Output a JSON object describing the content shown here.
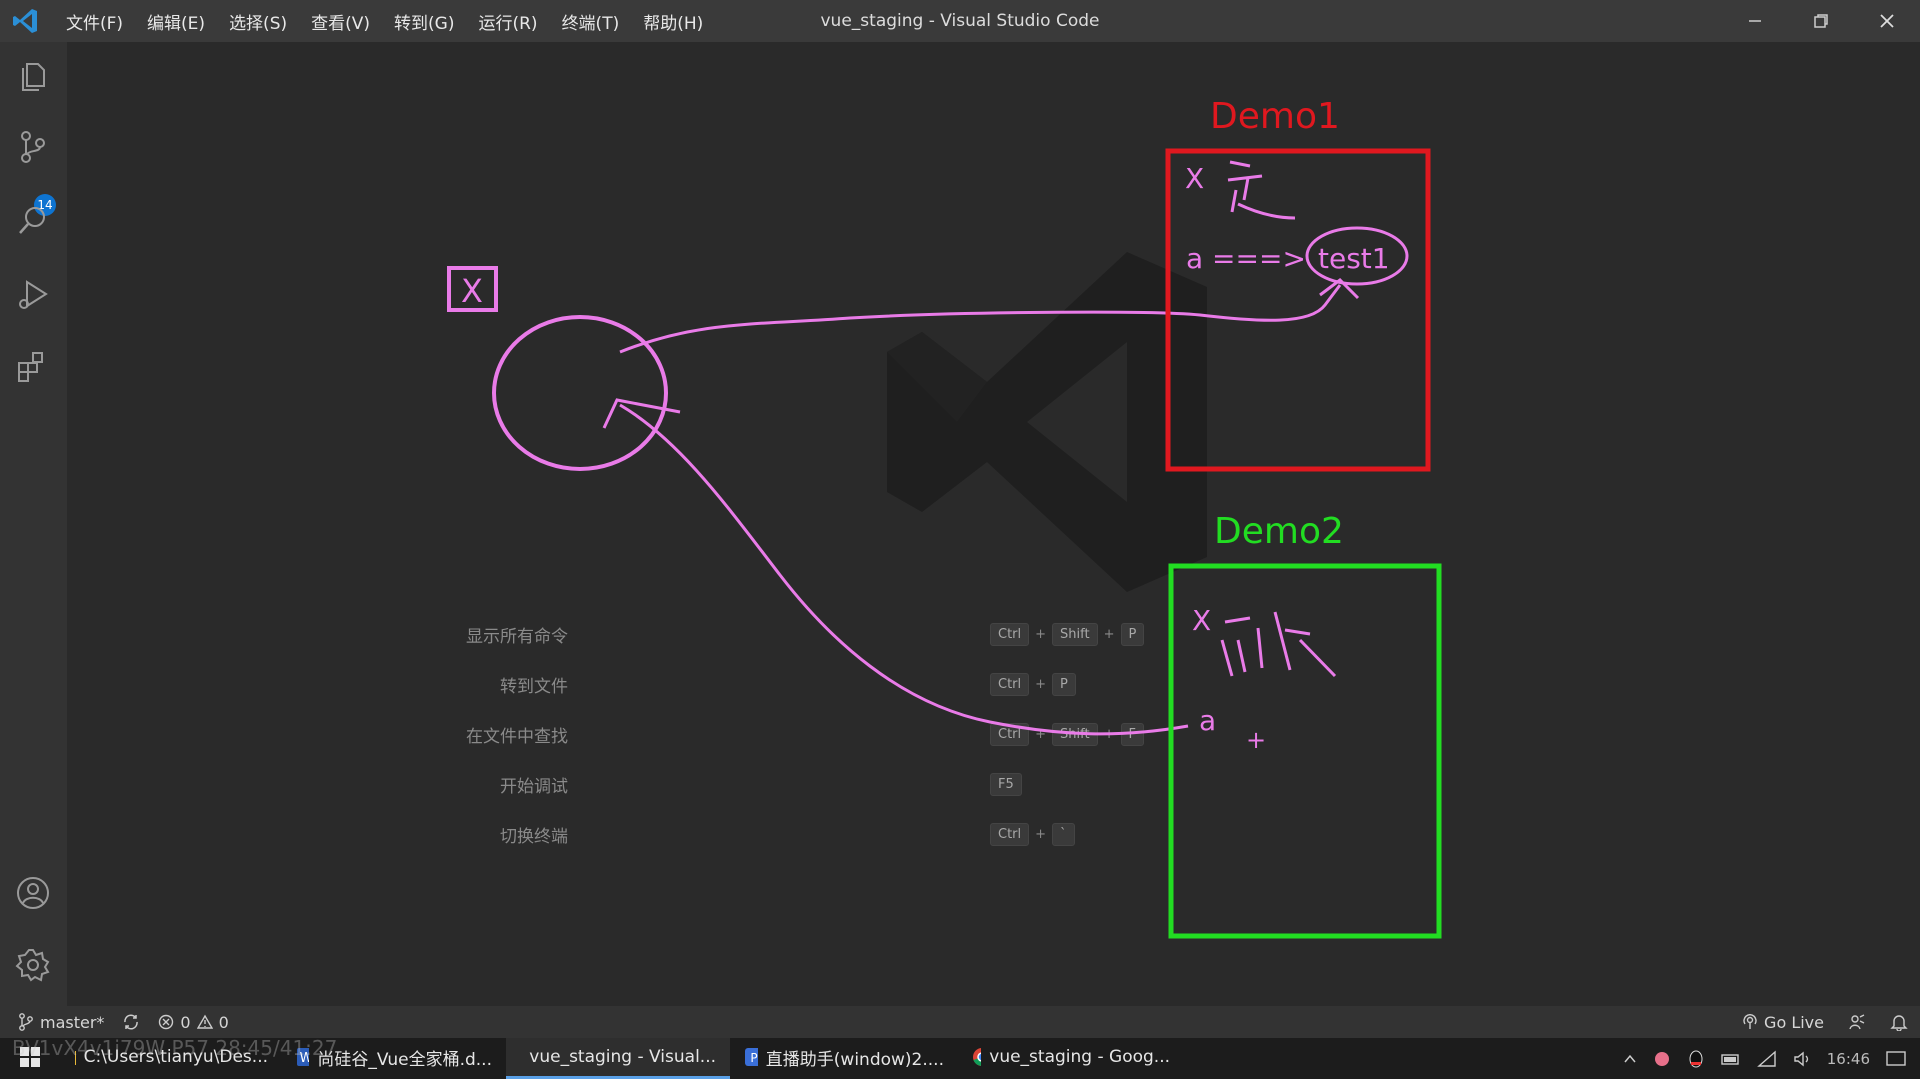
{
  "window": {
    "title": "vue_staging - Visual Studio Code",
    "menu": [
      "文件(F)",
      "编辑(E)",
      "选择(S)",
      "查看(V)",
      "转到(G)",
      "运行(R)",
      "终端(T)",
      "帮助(H)"
    ]
  },
  "activity_bar": {
    "scm_badge": "14"
  },
  "shortcuts": [
    {
      "label": "显示所有命令",
      "keys": [
        "Ctrl",
        "+",
        "Shift",
        "+",
        "P"
      ]
    },
    {
      "label": "转到文件",
      "keys": [
        "Ctrl",
        "+",
        "P"
      ]
    },
    {
      "label": "在文件中查找",
      "keys": [
        "Ctrl",
        "+",
        "Shift",
        "+",
        "F"
      ]
    },
    {
      "label": "开始调试",
      "keys": [
        "F5"
      ]
    },
    {
      "label": "切换终端",
      "keys": [
        "Ctrl",
        "+",
        "`"
      ]
    }
  ],
  "annotations": {
    "x_box": "X",
    "demo1_title": "Demo1",
    "demo1_x": "X",
    "demo1_a": "a ===>",
    "demo1_test": "test1",
    "demo2_title": "Demo2",
    "demo2_x": "X",
    "demo2_a": "a",
    "demo2_plus": "+",
    "colors": {
      "demo1": "#e0181f",
      "demo2": "#22dd22",
      "pen": "#e97be8"
    }
  },
  "statusbar": {
    "branch": "master*",
    "errors": "0",
    "warnings": "0",
    "go_live": "Go Live"
  },
  "taskbar": {
    "items": [
      {
        "label": "C:\\Users\\tianyu\\Des...",
        "icon": "folder-icon"
      },
      {
        "label": "尚硅谷_Vue全家桶.d...",
        "icon": "word-icon"
      },
      {
        "label": "vue_staging - Visual...",
        "icon": "vscode-icon",
        "active": true
      },
      {
        "label": "直播助手(window)2....",
        "icon": "app-icon"
      },
      {
        "label": "vue_staging - Goog...",
        "icon": "chrome-icon"
      }
    ],
    "clock": "16:46"
  },
  "video_overlay": "BV1vX4v1i79W P57 28:45/41:27"
}
